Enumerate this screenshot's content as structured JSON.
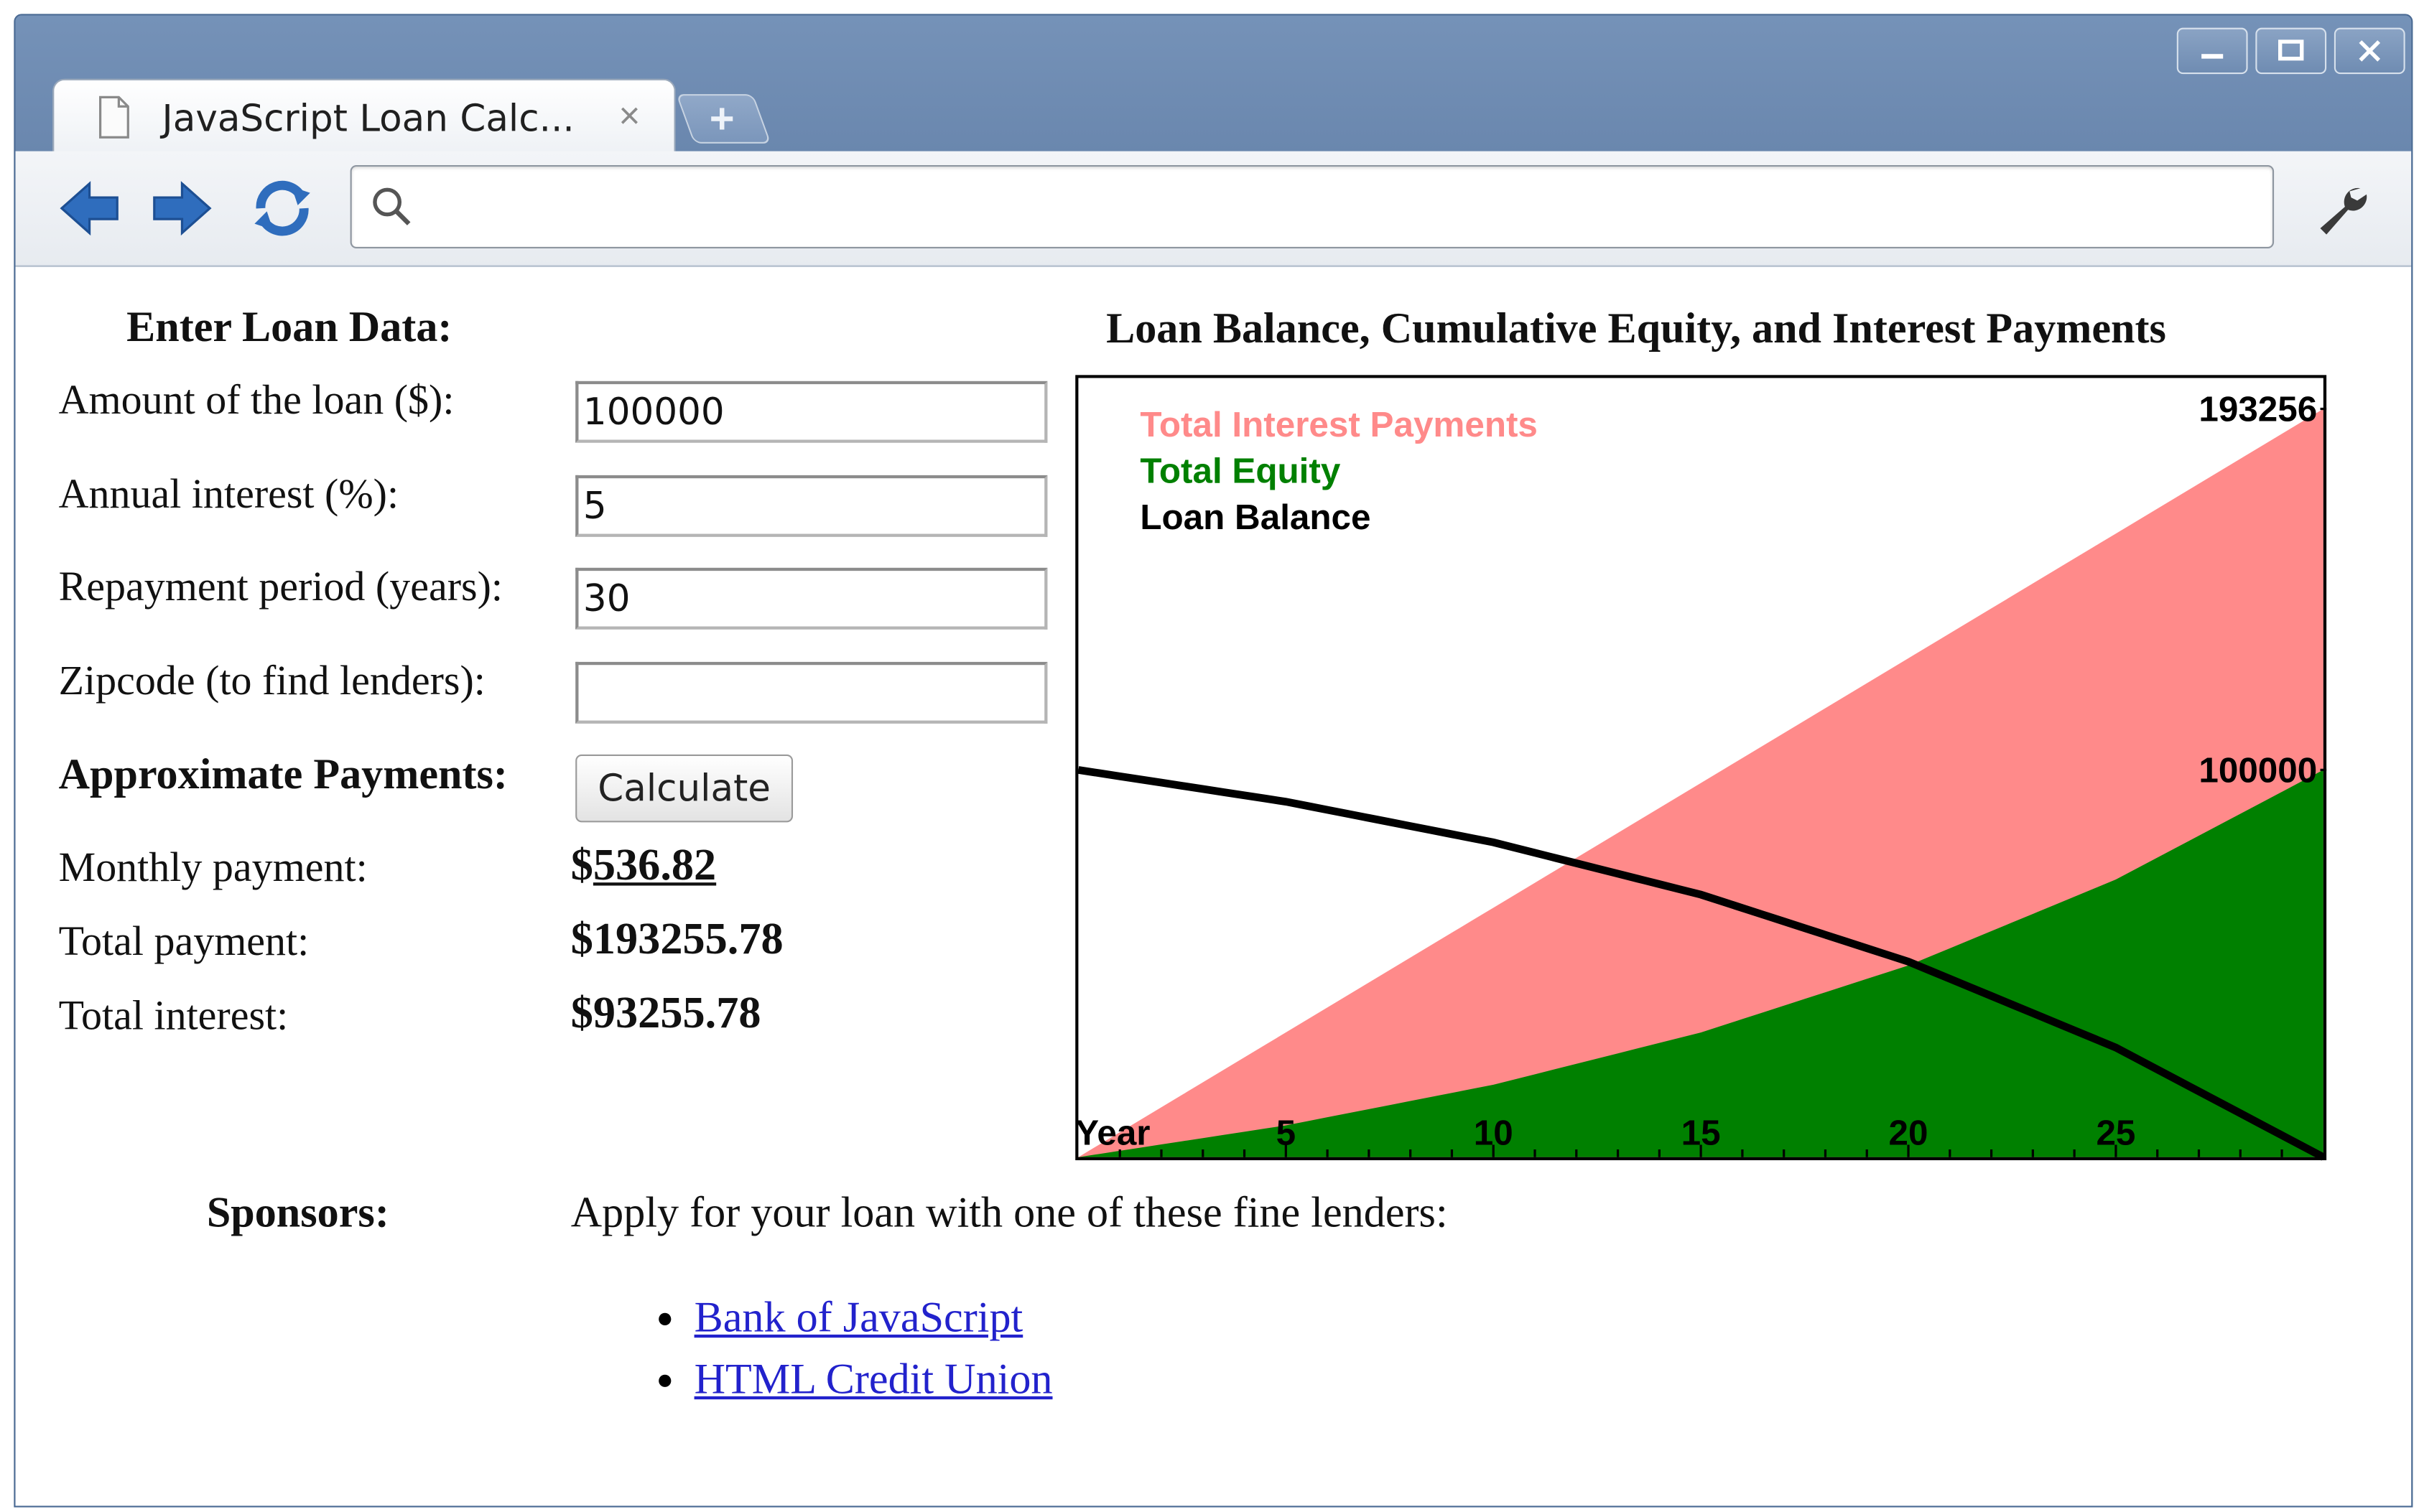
{
  "browser": {
    "tab_title": "JavaScript Loan Calc...",
    "tab_close": "×",
    "address_value": "",
    "icons": [
      "page-icon",
      "new-tab-icon",
      "back-arrow-icon",
      "forward-arrow-icon",
      "reload-icon",
      "search-icon",
      "wrench-icon",
      "minimize-icon",
      "maximize-icon",
      "close-icon"
    ]
  },
  "form": {
    "heading": "Enter Loan Data:",
    "amount_label": "Amount of the loan ($):",
    "amount_value": "100000",
    "interest_label": "Annual interest (%):",
    "interest_value": "5",
    "period_label": "Repayment period (years):",
    "period_value": "30",
    "zip_label": "Zipcode (to find lenders):",
    "zip_value": "",
    "payments_heading": "Approximate Payments:",
    "calculate_label": "Calculate",
    "monthly_label": "Monthly payment:",
    "monthly_currency": "$",
    "monthly_value": "536.82",
    "total_label": "Total payment:",
    "total_value": "$193255.78",
    "interest_total_label": "Total interest:",
    "interest_total_value": "$93255.78"
  },
  "sponsors": {
    "label": "Sponsors:",
    "intro": "Apply for your loan with one of these fine lenders:",
    "lenders": [
      "Bank of JavaScript",
      "HTML Credit Union"
    ]
  },
  "chart_data": {
    "type": "area",
    "title": "Loan Balance, Cumulative Equity, and Interest Payments",
    "xlabel": "Year",
    "x_ticks": [
      5,
      10,
      15,
      20,
      25
    ],
    "xlim": [
      0,
      30
    ],
    "ylim": [
      0,
      193256
    ],
    "y_labels": [
      "193256",
      "100000"
    ],
    "y_label_values": [
      193256,
      100000
    ],
    "legend": [
      "Total Interest Payments",
      "Total Equity",
      "Loan Balance"
    ],
    "legend_position": "top-left",
    "colors": {
      "interest": "#ff8a8a",
      "equity": "#008000",
      "balance": "#000000"
    },
    "series": [
      {
        "name": "Total Interest Payments",
        "style": "area",
        "x": [
          0,
          30
        ],
        "values": [
          0,
          193256
        ]
      },
      {
        "name": "Total Equity",
        "style": "area",
        "x": [
          0,
          5,
          10,
          15,
          20,
          25,
          30
        ],
        "values": [
          0,
          8200,
          18700,
          32200,
          49500,
          71700,
          100000
        ]
      },
      {
        "name": "Loan Balance",
        "style": "line",
        "x": [
          0,
          5,
          10,
          15,
          20,
          25,
          30
        ],
        "values": [
          100000,
          91800,
          81300,
          67800,
          50500,
          28300,
          0
        ]
      }
    ]
  }
}
